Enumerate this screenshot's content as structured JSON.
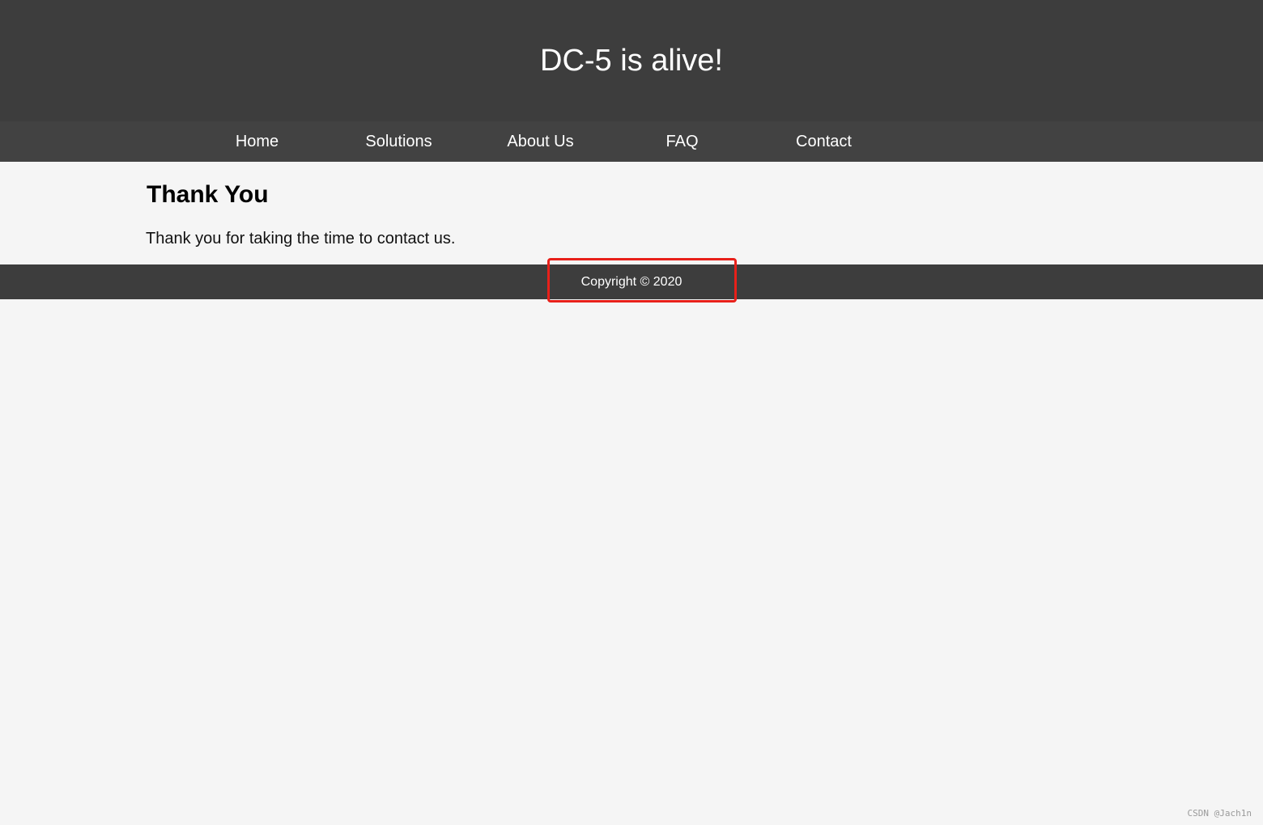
{
  "header": {
    "site_title": "DC-5 is alive!"
  },
  "nav": {
    "items": [
      {
        "label": "Home"
      },
      {
        "label": "Solutions"
      },
      {
        "label": "About Us"
      },
      {
        "label": "FAQ"
      },
      {
        "label": "Contact"
      }
    ]
  },
  "main": {
    "heading": "Thank You",
    "message": "Thank you for taking the time to contact us."
  },
  "footer": {
    "copyright": "Copyright © 2020"
  },
  "annotation": {
    "highlight_color": "#e8201a"
  },
  "watermark": {
    "text": "CSDN @Jach1n"
  },
  "colors": {
    "header_bg": "#3d3d3d",
    "nav_bg": "#424242",
    "page_bg": "#f5f5f5",
    "footer_bg": "#3d3d3d"
  }
}
